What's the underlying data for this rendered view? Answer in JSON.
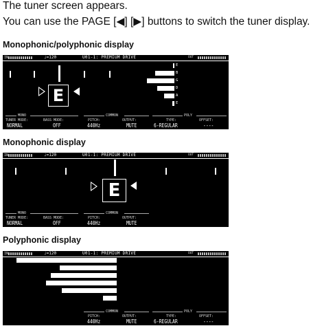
{
  "intro": {
    "line1": "The tuner screen appears.",
    "line2": "You can use the PAGE [◀] [▶] buttons to switch the tuner display."
  },
  "display": {
    "in_label": "IN",
    "out_label": "OUT",
    "tempo": "♩=120",
    "patch": "U01-1: PREMIUM DRIVE",
    "note": "E",
    "strings": [
      "E",
      "B",
      "G",
      "D",
      "A",
      "E"
    ],
    "groups": {
      "mono": "MONO",
      "common": "COMMON",
      "poly": "POLY"
    },
    "params": {
      "tuner_mode": {
        "label": "TUNER MODE:",
        "value": "NORMAL"
      },
      "bass_mode": {
        "label": "BASS MODE:",
        "value": "OFF"
      },
      "pitch": {
        "label": "PITCH:",
        "value": "440Hz"
      },
      "output": {
        "label": "OUTPUT:",
        "value": "MUTE"
      },
      "type": {
        "label": "TYPE:",
        "value": "6-REGULAR"
      },
      "offset": {
        "label": "OFFSET:",
        "value": "----"
      }
    }
  },
  "sections": {
    "monopoly": "Monophonic/polyphonic display",
    "mono": "Monophonic display",
    "poly": "Polyphonic display"
  },
  "poly_levels": [
    0.88,
    0.5,
    0.58,
    0.62,
    0.48,
    0.12
  ],
  "monopoly_levels": [
    0.02,
    0.5,
    0.72,
    0.45,
    0.28,
    0.06
  ]
}
